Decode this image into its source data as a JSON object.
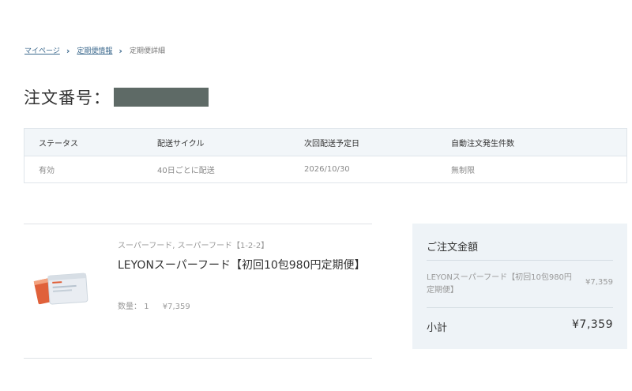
{
  "breadcrumb": {
    "mypage": "マイページ",
    "subscription_info": "定期便情報",
    "current": "定期便詳細",
    "separator": "›"
  },
  "order": {
    "title": "注文番号："
  },
  "status_table": {
    "headers": [
      "ステータス",
      "配送サイクル",
      "次回配送予定日",
      "自動注文発生件数"
    ],
    "values": [
      "有効",
      "40日ごとに配送",
      "2026/10/30",
      "無制限"
    ]
  },
  "item": {
    "category": "スーパーフード, スーパーフード【1-2-2】",
    "name": "LEYONスーパーフード【初回10包980円定期便】",
    "quantity_label": "数量：",
    "quantity": "1",
    "price": "¥7,359"
  },
  "summary": {
    "heading": "ご注文金額",
    "line_item_name": "LEYONスーパーフード【初回10包980円定期便】",
    "line_item_price": "¥7,359",
    "subtotal_label": "小計",
    "subtotal_value": "¥7,359"
  },
  "colors": {
    "link": "#3d6a8e",
    "table_header_bg": "#f2f6f9",
    "summary_bg": "#eef3f7",
    "redaction": "#5e6a66"
  }
}
